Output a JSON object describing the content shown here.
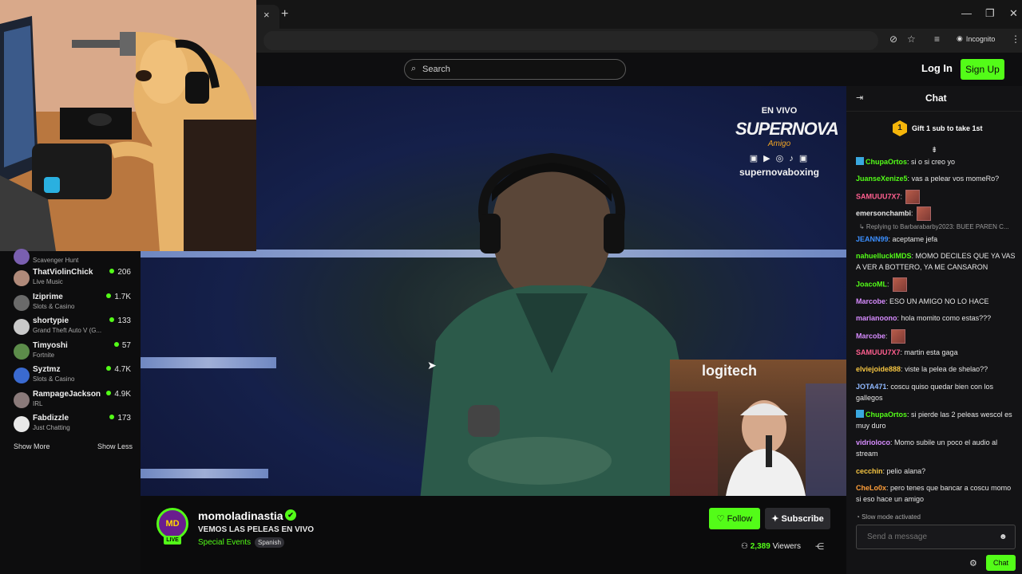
{
  "browser": {
    "incognito_label": "Incognito",
    "tab_close": "×",
    "new_tab": "+",
    "window_min": "—",
    "window_restore": "❐",
    "window_close": "✕"
  },
  "nav": {
    "search_placeholder": "Search",
    "login_label": "Log In",
    "signup_label": "Sign Up"
  },
  "video_overlay": {
    "line1": "EN VIVO",
    "line2": "SUPERNOVA",
    "line3": "Amigo",
    "social_icons": "▣ ▶ ◎ ♪ ▣",
    "handle": "supernovaboxing",
    "cam_brand": "logitech"
  },
  "sidebar": {
    "items": [
      {
        "name": "",
        "category": "Scavenger Hunt",
        "viewers": "",
        "color": "#7a5fb0"
      },
      {
        "name": "ThatViolinChick",
        "category": "Live Music",
        "viewers": "206",
        "color": "#b08a7a"
      },
      {
        "name": "Iziprime",
        "category": "Slots & Casino",
        "viewers": "1.7K",
        "color": "#6a6a6a"
      },
      {
        "name": "shortypie",
        "category": "Grand Theft Auto V (G...",
        "viewers": "133",
        "color": "#c9c9c9"
      },
      {
        "name": "Timyoshi",
        "category": "Fortnite",
        "viewers": "57",
        "color": "#5c8c4a"
      },
      {
        "name": "Syztmz",
        "category": "Slots & Casino",
        "viewers": "4.7K",
        "color": "#3a6ad0"
      },
      {
        "name": "RampageJackson",
        "category": "IRL",
        "viewers": "4.9K",
        "color": "#8a7a7a"
      },
      {
        "name": "Fabdizzle",
        "category": "Just Chatting",
        "viewers": "173",
        "color": "#e8e8e8"
      }
    ],
    "show_more": "Show More",
    "show_less": "Show Less"
  },
  "stream": {
    "avatar_text": "MD",
    "live_badge": "LIVE",
    "channel_name": "momoladinastia",
    "verified_mark": "✔",
    "title": "VEMOS LAS PELEAS EN VIVO",
    "category": "Special Events",
    "language": "Spanish",
    "follow_label": "Follow",
    "subscribe_label": "Subscribe",
    "viewer_count": "2,389",
    "viewers_label": "Viewers"
  },
  "chat": {
    "title": "Chat",
    "gift_badge": "1",
    "gift_text": "Gift 1 sub to take 1st",
    "reply_context": "↳ Replying to Barbarabarby2023: BUEE PAREN C...",
    "messages": [
      {
        "user": "ChupaOrtos",
        "color": "#53fc18",
        "text": " si o si creo yo",
        "sub": true,
        "emote": false
      },
      {
        "user": "JuanseXenize5",
        "color": "#53fc18",
        "text": " vas a pelear vos momeRo?",
        "sub": false,
        "emote": false
      },
      {
        "user": "SAMUUU7X7",
        "color": "#ff5f8f",
        "text": "",
        "sub": false,
        "emote": true
      },
      {
        "user": "emersonchambi",
        "color": "#e6e6e6",
        "text": "",
        "sub": false,
        "emote": true
      },
      {
        "user": "JEANN99",
        "color": "#3b8fff",
        "text": " aceptame jefa",
        "sub": false,
        "emote": false
      },
      {
        "user": "nahuellucklMDS",
        "color": "#53fc18",
        "text": " MOMO DECILES QUE YA VAS A VER A BOTTERO, YA ME CANSARON",
        "sub": false,
        "emote": false
      },
      {
        "user": "JoacoML",
        "color": "#53fc18",
        "text": "",
        "sub": false,
        "emote": true
      },
      {
        "user": "Marcobe",
        "color": "#d78cff",
        "text": " ESO UN AMIGO NO LO HACE",
        "sub": false,
        "emote": false
      },
      {
        "user": "marianoono",
        "color": "#d78cff",
        "text": " hola momito como estas???",
        "sub": false,
        "emote": false
      },
      {
        "user": "Marcobe",
        "color": "#d78cff",
        "text": "",
        "sub": false,
        "emote": true
      },
      {
        "user": "SAMUUU7X7",
        "color": "#ff5f8f",
        "text": " martin esta gaga",
        "sub": false,
        "emote": false
      },
      {
        "user": "elviejoide888",
        "color": "#f5c542",
        "text": " viste la pelea de shelao??",
        "sub": false,
        "emote": false
      },
      {
        "user": "JOTA471",
        "color": "#8fb8ff",
        "text": " coscu quiso quedar bien con los gallegos",
        "sub": false,
        "emote": false
      },
      {
        "user": "ChupaOrtos",
        "color": "#53fc18",
        "text": " si pierde las 2 peleas wescol es muy duro",
        "sub": true,
        "emote": false
      },
      {
        "user": "vidrioloco",
        "color": "#d78cff",
        "text": " Momo subile un poco el audio al stream",
        "sub": false,
        "emote": false
      },
      {
        "user": "cecchin",
        "color": "#f5c542",
        "text": " pelio alana?",
        "sub": false,
        "emote": false
      },
      {
        "user": "CheLo0x",
        "color": "#ff9f3a",
        "text": " pero tenes que bancar a coscu momo si eso hace un amigo",
        "sub": false,
        "emote": false
      }
    ],
    "slow_mode": "Slow mode activated",
    "input_placeholder": "Send a message",
    "send_label": "Chat"
  }
}
